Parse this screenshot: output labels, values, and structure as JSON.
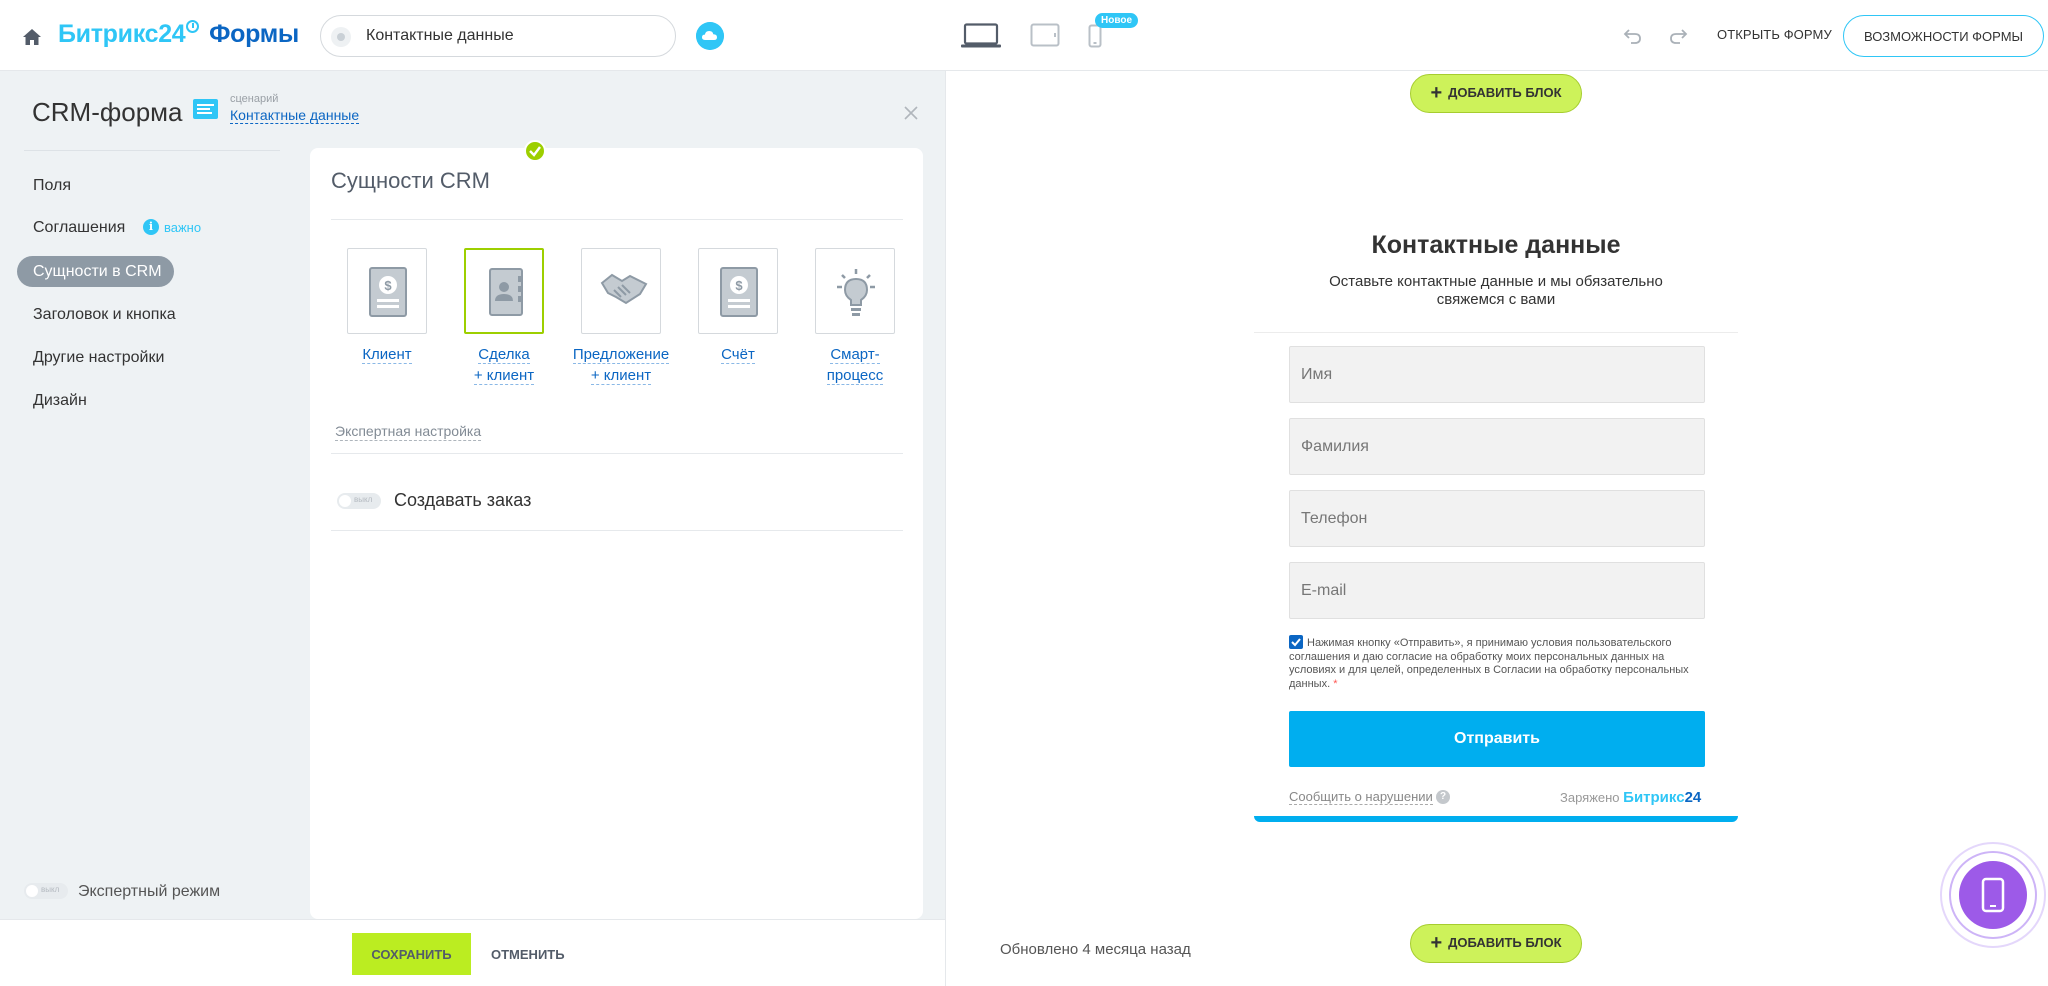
{
  "header": {
    "logo_part1": "Битрикс24",
    "logo_part2": "Формы",
    "form_name": "Контактные данные",
    "new_badge": "Новое",
    "open_form": "ОТКРЫТЬ ФОРМУ",
    "features": "ВОЗМОЖНОСТИ ФОРМЫ"
  },
  "sidebar": {
    "title": "CRM-форма",
    "scenario_label": "сценарий",
    "scenario_value": "Контактные данные",
    "items": [
      {
        "label": "Поля"
      },
      {
        "label": "Соглашения",
        "badge": "важно"
      },
      {
        "label": "Сущности в CRM",
        "active": true
      },
      {
        "label": "Заголовок и кнопка"
      },
      {
        "label": "Другие настройки"
      },
      {
        "label": "Дизайн"
      }
    ],
    "expert_toggle_state": "выкл",
    "expert_mode": "Экспертный режим"
  },
  "crm_entities": {
    "title": "Сущности CRM",
    "options": [
      {
        "label_line1": "Клиент",
        "label_line2": "",
        "icon": "client-icon"
      },
      {
        "label_line1": "Сделка",
        "label_line2": "+ клиент",
        "icon": "deal-icon",
        "selected": true
      },
      {
        "label_line1": "Предложение",
        "label_line2": "+ клиент",
        "icon": "handshake-icon"
      },
      {
        "label_line1": "Счёт",
        "label_line2": "",
        "icon": "invoice-icon"
      },
      {
        "label_line1": "Смарт-",
        "label_line2": "процесс",
        "icon": "lightbulb-icon"
      }
    ],
    "expert_setting": "Экспертная настройка",
    "order_toggle_state": "выкл",
    "create_order": "Создавать заказ"
  },
  "actions": {
    "save": "СОХРАНИТЬ",
    "cancel": "ОТМЕНИТЬ"
  },
  "preview": {
    "add_block": "ДОБАВИТЬ БЛОК",
    "form_title": "Контактные данные",
    "form_subtitle_line1": "Оставьте контактные данные и мы обязательно",
    "form_subtitle_line2": "свяжемся с вами",
    "fields": [
      "Имя",
      "Фамилия",
      "Телефон",
      "E-mail"
    ],
    "consent": "Нажимая кнопку «Отправить», я принимаю условия пользовательского соглашения и даю согласие на обработку моих персональных данных на условиях и для целей, определенных в Согласии на обработку персональных данных.",
    "consent_required_mark": "*",
    "submit": "Отправить",
    "report": "Сообщить о нарушении",
    "powered_by": "Заряжено",
    "powered_brand": "Битрикс",
    "powered_brand_num": "24",
    "updated": "Обновлено 4 месяца назад"
  },
  "colors": {
    "accent": "#2fc6f6",
    "brand_dark": "#0b66c3",
    "save_green": "#bbed21",
    "selected_green": "#9dcf00",
    "submit_blue": "#00aeef",
    "fab_purple": "#9d5ae8"
  }
}
